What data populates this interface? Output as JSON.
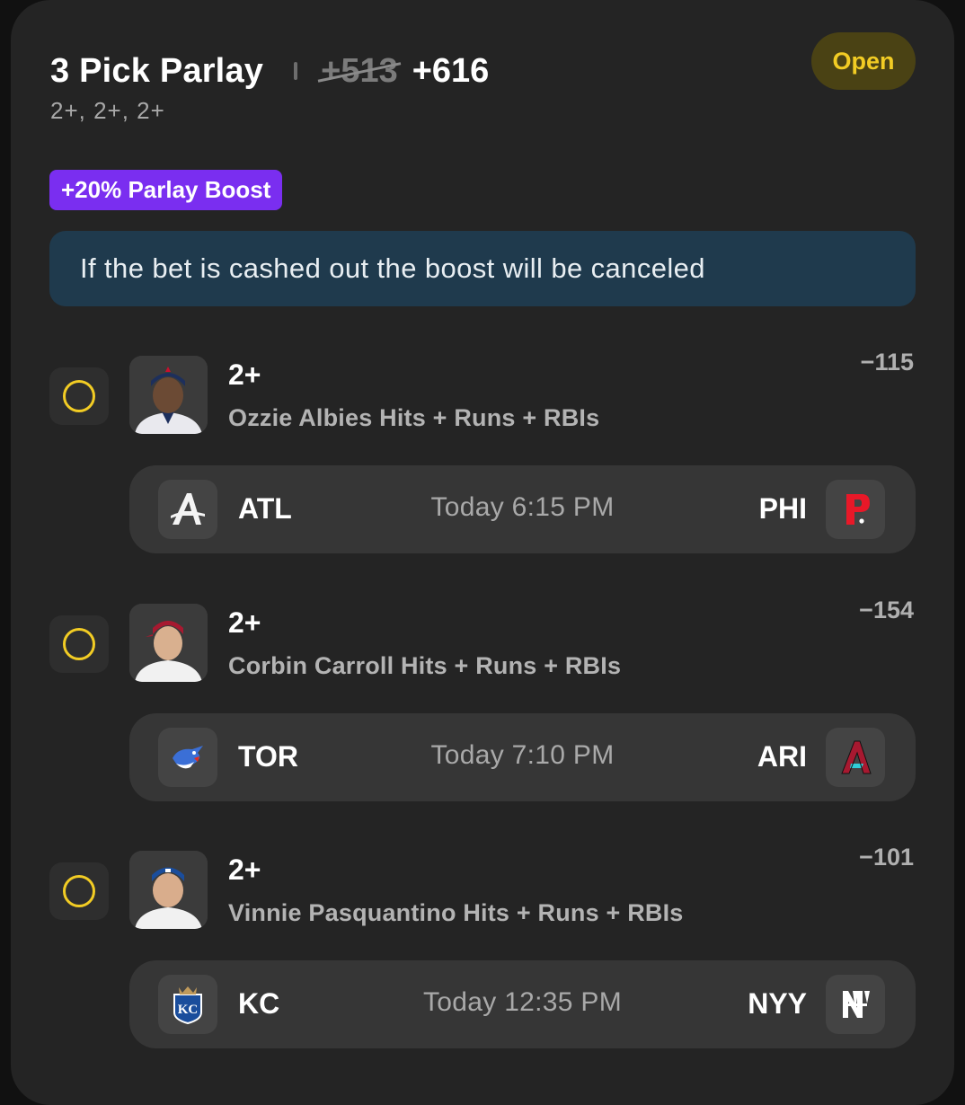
{
  "header": {
    "title": "3 Pick Parlay",
    "old_odds": "+513",
    "new_odds": "+616",
    "subtitle": "2+, 2+, 2+",
    "status": "Open"
  },
  "boost": {
    "label": "+20% Parlay Boost",
    "notice": "If the bet is cashed out the boost will be canceled"
  },
  "legs": [
    {
      "line": "2+",
      "market": "Ozzie Albies Hits + Runs + RBIs",
      "odds": "−115",
      "away_team": "ATL",
      "home_team": "PHI",
      "time": "Today 6:15 PM",
      "away_logo": "braves-logo",
      "home_logo": "phillies-logo"
    },
    {
      "line": "2+",
      "market": "Corbin Carroll Hits + Runs + RBIs",
      "odds": "−154",
      "away_team": "TOR",
      "home_team": "ARI",
      "time": "Today 7:10 PM",
      "away_logo": "blue-jays-logo",
      "home_logo": "diamondbacks-logo"
    },
    {
      "line": "2+",
      "market": "Vinnie Pasquantino Hits + Runs + RBIs",
      "odds": "−101",
      "away_team": "KC",
      "home_team": "NYY",
      "time": "Today 12:35 PM",
      "away_logo": "royals-logo",
      "home_logo": "yankees-logo"
    }
  ],
  "colors": {
    "card_bg": "#242424",
    "accent_yellow": "#f2cc24",
    "boost_purple": "#7a2ef0",
    "notice_bg": "#1f3a4d"
  }
}
